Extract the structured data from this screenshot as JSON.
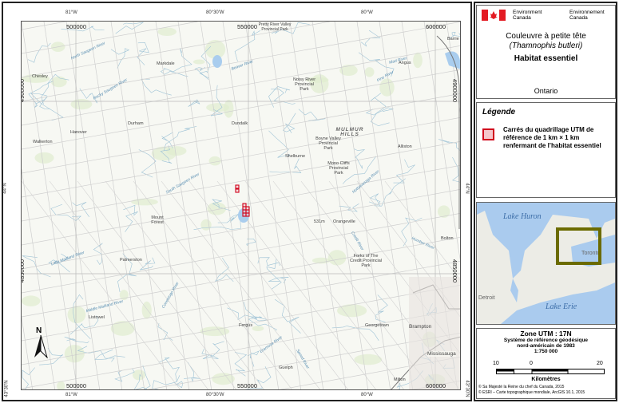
{
  "title_block": {
    "dept_en": "Environment Canada",
    "dept_fr": "Environnement Canada",
    "species": "Couleuvre à petite tête",
    "latin": "(Thamnophis butleri)",
    "subtitle": "Habitat essentiel",
    "province": "Ontario"
  },
  "legend": {
    "title": "Légende",
    "item": "Carrés du quadrillage UTM de référence de 1 km × 1 km renfermant de l’habitat essentiel",
    "colors": {
      "border": "#d0021b",
      "fill": "#f5c6cb"
    }
  },
  "inset": {
    "labels": [
      "Lake Huron",
      "Toronto",
      "Detroit",
      "Lake Erie"
    ],
    "extent_color": "#6b6b00"
  },
  "info": {
    "zone": "Zone UTM : 17N",
    "datum1": "Système de référence géodésique",
    "datum2": "nord-américain de 1983",
    "scale": "1:750 000",
    "scale_ticks": [
      "10",
      "0",
      "20"
    ],
    "unit": "Kilomètres",
    "credit1": "© Sa Majesté la Reine du chef du Canada, 2015",
    "credit2": "© ESRI – Carte topographique mondiale, ArcGIS 10.1, 2015"
  },
  "map": {
    "longitudes": [
      "81°W",
      "80°30'W",
      "80°W"
    ],
    "eastings": [
      "500000",
      "550000",
      "600000"
    ],
    "northings": [
      "4900000",
      "4850000"
    ],
    "latitudes": [
      "44°N",
      "43°30'N"
    ],
    "north_arrow": "N",
    "places": [
      "Barrie",
      "Markdale",
      "Chesley",
      "Angus",
      "Noisy River Provincial Park",
      "Boyne Valley Provincial Park",
      "Mono Cliffs Provincial Park",
      "Dundalk",
      "Durham",
      "Hanover",
      "Walkerton",
      "Shelburne",
      "Alliston",
      "Mount Forest",
      "Orangeville",
      "Bolton",
      "Forks of The Credit Provincial Park",
      "Palmerston",
      "Listowel",
      "Fergus",
      "Brampton",
      "Georgetown",
      "Guelph",
      "Milton",
      "Mississauga",
      "Pretty River Valley Provincial Park"
    ],
    "hills": "MULMUR HILLS",
    "rivers": [
      "Beaver River",
      "North Saugeen River",
      "Rocky Saugeen River",
      "Saugeen River",
      "Nottawasaga River",
      "Mad River",
      "Pine River",
      "South Saugeen River",
      "Humber River",
      "Credit River",
      "Little Maitland River",
      "Middle Maitland River",
      "Conestogo River",
      "Eramosa River",
      "Speed River"
    ],
    "elevation": "531m"
  }
}
